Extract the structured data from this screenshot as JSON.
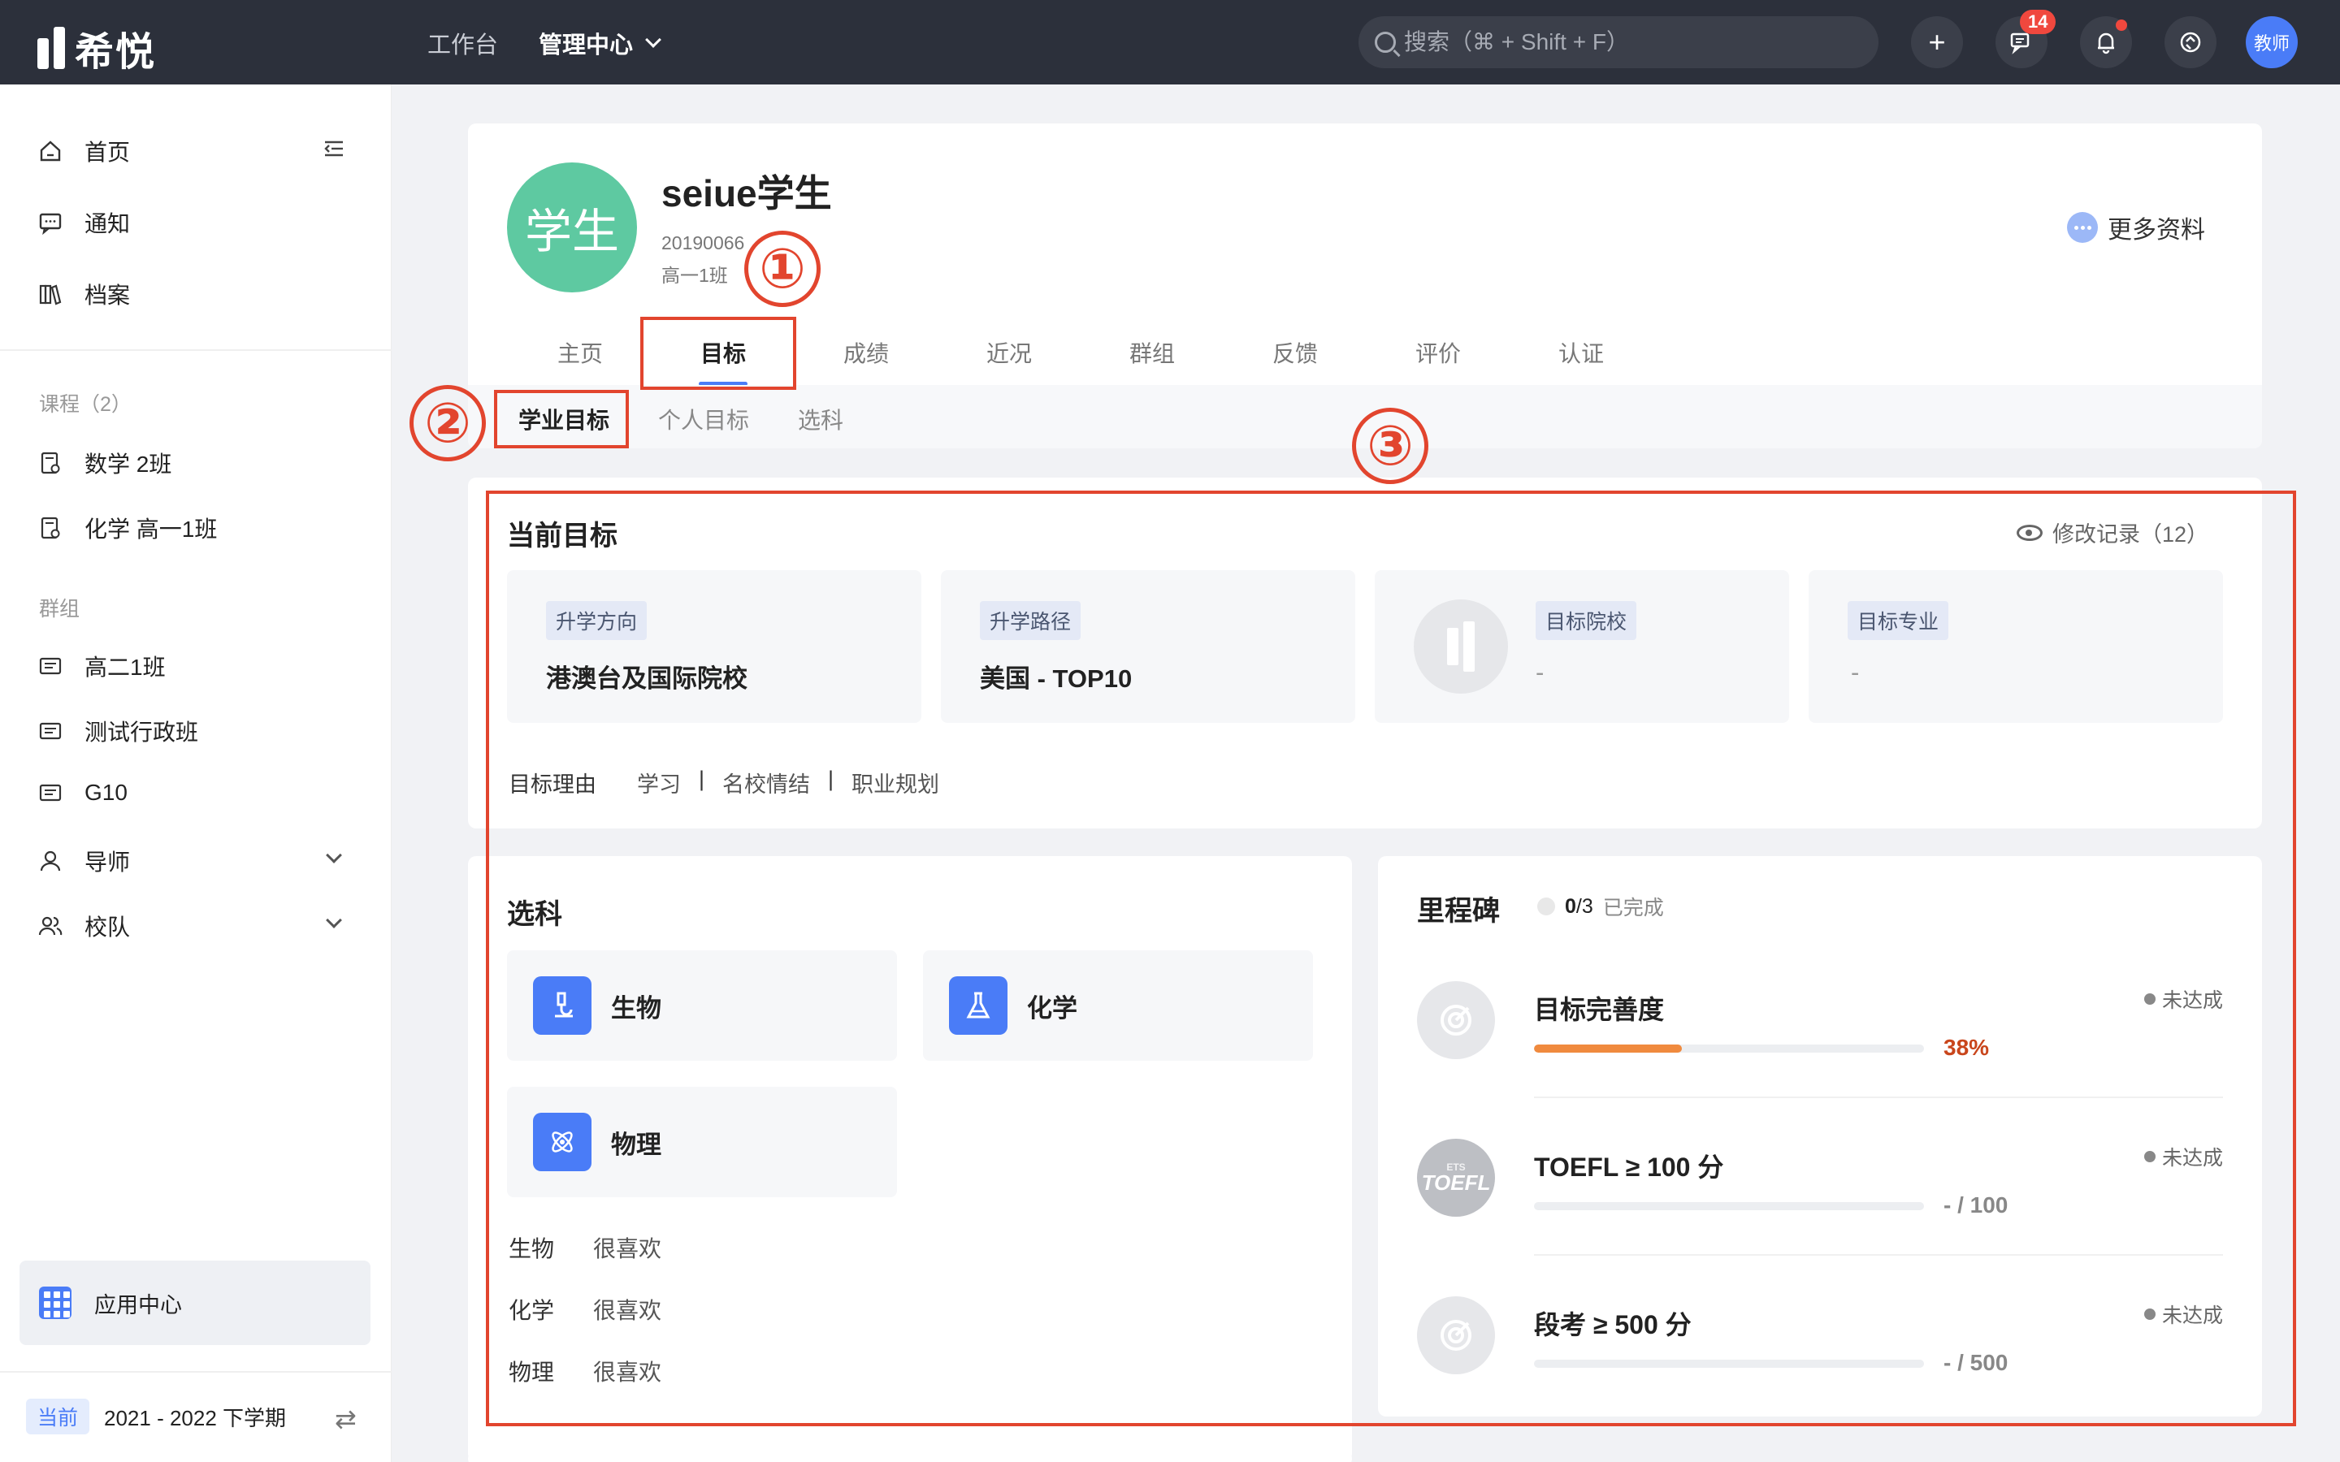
{
  "app": {
    "logo_text": "希悦"
  },
  "topnav": {
    "workbench": "工作台",
    "admin": "管理中心"
  },
  "search": {
    "placeholder": "搜索（⌘ + Shift + F）"
  },
  "header_actions": {
    "messages_count": "14",
    "avatar_label": "教师"
  },
  "sidebar": {
    "home": "首页",
    "notice": "通知",
    "archive": "档案",
    "courses_title": "课程（2）",
    "courses": [
      "数学 2班",
      "化学 高一1班"
    ],
    "groups_title": "群组",
    "groups": [
      "高二1班",
      "测试行政班",
      "G10"
    ],
    "mentor": "导师",
    "team": "校队",
    "app_center": "应用中心",
    "term_current": "当前",
    "term": "2021 - 2022 下学期"
  },
  "profile": {
    "avatar_text": "学生",
    "name": "seiue学生",
    "student_id": "20190066",
    "class": "高一1班",
    "more": "更多资料",
    "tabs": [
      "主页",
      "目标",
      "成绩",
      "近况",
      "群组",
      "反馈",
      "评价",
      "认证"
    ],
    "active_tab": "目标",
    "subtabs": [
      "学业目标",
      "个人目标",
      "选科"
    ],
    "active_subtab": "学业目标"
  },
  "goal": {
    "title": "当前目标",
    "modify_log": "修改记录（12）",
    "boxes": [
      {
        "tag": "升学方向",
        "value": "港澳台及国际院校"
      },
      {
        "tag": "升学路径",
        "value": "美国 - TOP10"
      },
      {
        "tag": "目标院校",
        "value": "-"
      },
      {
        "tag": "目标专业",
        "value": "-"
      }
    ],
    "reason_label": "目标理由",
    "reasons": [
      "学习",
      "名校情结",
      "职业规划"
    ],
    "separator": "|"
  },
  "subjects": {
    "title": "选科",
    "items": [
      "生物",
      "化学",
      "物理"
    ],
    "preferences": [
      {
        "subject": "生物",
        "level": "很喜欢"
      },
      {
        "subject": "化学",
        "level": "很喜欢"
      },
      {
        "subject": "物理",
        "level": "很喜欢"
      }
    ]
  },
  "milestones": {
    "title": "里程碑",
    "done": "0",
    "total": "/3",
    "done_label": "已完成",
    "items": [
      {
        "title": "目标完善度",
        "status": "未达成",
        "value": "38%",
        "progress": 0.38
      },
      {
        "title": "TOEFL ≥ 100 分",
        "status": "未达成",
        "value": "- / 100",
        "progress": 0
      },
      {
        "title": "段考 ≥ 500 分",
        "status": "未达成",
        "value": "- / 500",
        "progress": 0
      }
    ],
    "toefl_logo_small": "ETS",
    "toefl_logo": "TOEFL"
  },
  "annotations": [
    "①",
    "②",
    "③"
  ],
  "colors": {
    "accent": "#4a7cf7",
    "annotation": "#e2452e",
    "progress": "#f08a3e",
    "avatar": "#5ec9a1"
  }
}
